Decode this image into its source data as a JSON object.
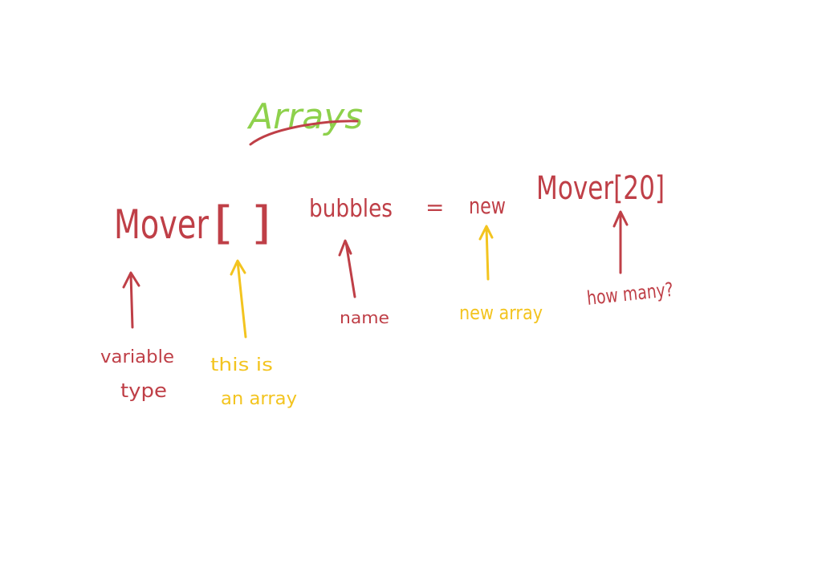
{
  "title": "Arrays",
  "statement": {
    "type": "Mover",
    "brackets": "[ ]",
    "name": "bubbles",
    "equals": "=",
    "keyword": "new",
    "constructor": "Mover[20]"
  },
  "annotations": {
    "variable_type": [
      "variable",
      "type"
    ],
    "this_is_an_array": [
      "this is",
      "an array"
    ],
    "name": "name",
    "new_array": "new array",
    "how_many": "how many?"
  },
  "colors": {
    "title": "#8ed14c",
    "primary_ink": "#bf3f47",
    "highlight_ink": "#f3c41f",
    "background": "#ffffff"
  }
}
